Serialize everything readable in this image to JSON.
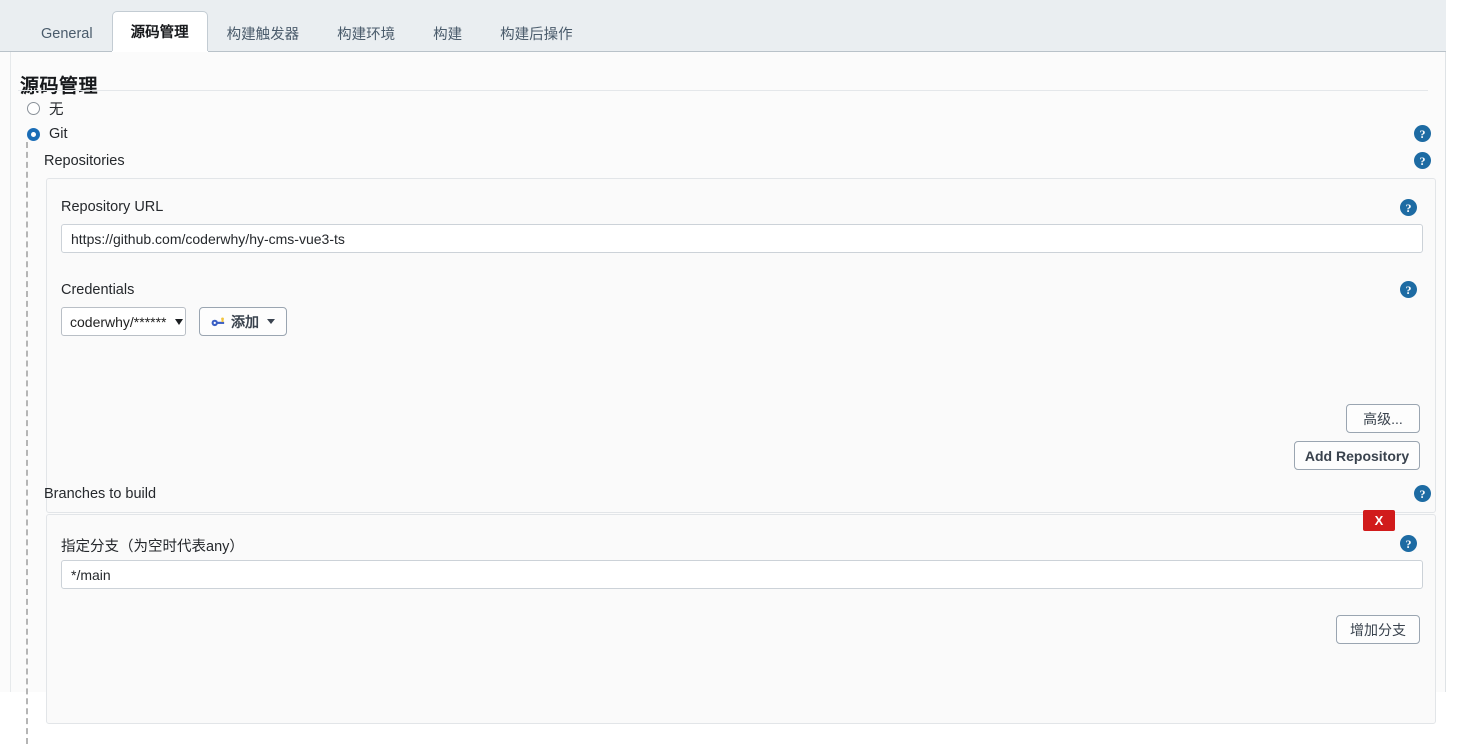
{
  "colors": {
    "accent_blue": "#1d6ba3",
    "radio_blue": "#1a6cb5",
    "delete_red": "#d11b1b",
    "tabbar_bg": "#eaeef1",
    "page_bg": "#fbfbfb",
    "panel_bg": "#fafafa"
  },
  "tabs": [
    {
      "label": "General",
      "active": false
    },
    {
      "label": "源码管理",
      "active": true
    },
    {
      "label": "构建触发器",
      "active": false
    },
    {
      "label": "构建环境",
      "active": false
    },
    {
      "label": "构建",
      "active": false
    },
    {
      "label": "构建后操作",
      "active": false
    }
  ],
  "page": {
    "title": "源码管理"
  },
  "scm": {
    "options": [
      {
        "label": "无",
        "selected": false
      },
      {
        "label": "Git",
        "selected": true
      }
    ]
  },
  "repositories": {
    "section_label": "Repositories",
    "url_label": "Repository URL",
    "url_value": "https://github.com/coderwhy/hy-cms-vue3-ts",
    "url_placeholder": "",
    "credentials_label": "Credentials",
    "credentials_selected": "coderwhy/******",
    "add_credentials_label": "添加",
    "advanced_label": "高级...",
    "add_repository_label": "Add Repository"
  },
  "branches": {
    "section_label": "Branches to build",
    "branch_label": "指定分支（为空时代表any）",
    "branch_value": "*/main",
    "branch_placeholder": "",
    "delete_label": "X",
    "add_branch_label": "增加分支"
  },
  "help": {
    "glyph": "?"
  },
  "icons": {
    "key": "key-icon",
    "caret": "chevron-down-icon"
  }
}
